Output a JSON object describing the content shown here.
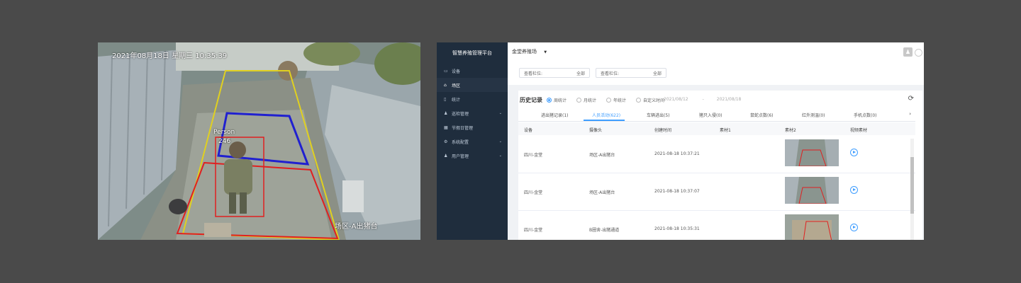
{
  "camera": {
    "timestamp": "2021年08月18日 星期三 10:35:39",
    "person_label": "Person",
    "person_id": "246",
    "zone_label": "场区-A出猪台"
  },
  "app": {
    "brand": "智慧养殖管理平台",
    "farm_selector": "金堂养殖场",
    "sidebar": {
      "items": [
        {
          "label": "设备",
          "icon": "video-icon"
        },
        {
          "label": "场区",
          "icon": "home-icon"
        },
        {
          "label": "统计",
          "icon": "document-icon"
        },
        {
          "label": "巡检管理",
          "icon": "user-group-icon"
        },
        {
          "label": "节假日管理",
          "icon": "calendar-icon"
        },
        {
          "label": "系统配置",
          "icon": "gear-icon"
        },
        {
          "label": "用户管理",
          "icon": "user-icon"
        }
      ]
    },
    "filters": {
      "filter1": {
        "label": "查看栏位:",
        "value": "全部"
      },
      "filter2": {
        "label": "查看栏位:",
        "value": "全部"
      }
    },
    "history": {
      "title": "历史记录",
      "radios": [
        "周统计",
        "月统计",
        "年统计",
        "自定义时间"
      ],
      "date_start": "2021/08/12",
      "date_sep": "-",
      "date_end": "2021/08/18"
    },
    "tabs": [
      {
        "label": "进出猪记录(1)"
      },
      {
        "label": "人员活动(622)"
      },
      {
        "label": "车辆进出(5)"
      },
      {
        "label": "猪只入侵(0)"
      },
      {
        "label": "鼠蛇点数(6)"
      },
      {
        "label": "红外测温(0)"
      },
      {
        "label": "手机点数(0)"
      }
    ],
    "table": {
      "headers": [
        "设备",
        "摄像头",
        "创建时间",
        "素材1",
        "素材2",
        "视频素材"
      ],
      "rows": [
        {
          "device": "四川-金堂",
          "camera": "场区-A出猪台",
          "time": "2021-08-18 10:37:21"
        },
        {
          "device": "四川-金堂",
          "camera": "场区-A出猪台",
          "time": "2021-08-18 10:37:07"
        },
        {
          "device": "四川-金堂",
          "camera": "B圈舍-出猪通道",
          "time": "2021-08-18 10:35:31"
        }
      ]
    }
  },
  "colors": {
    "accent": "#409eff",
    "sidebar": "#1f2d3d",
    "detect_red": "#e02020",
    "zone_blue": "#2020d0",
    "zone_yellow": "#e0d020"
  }
}
